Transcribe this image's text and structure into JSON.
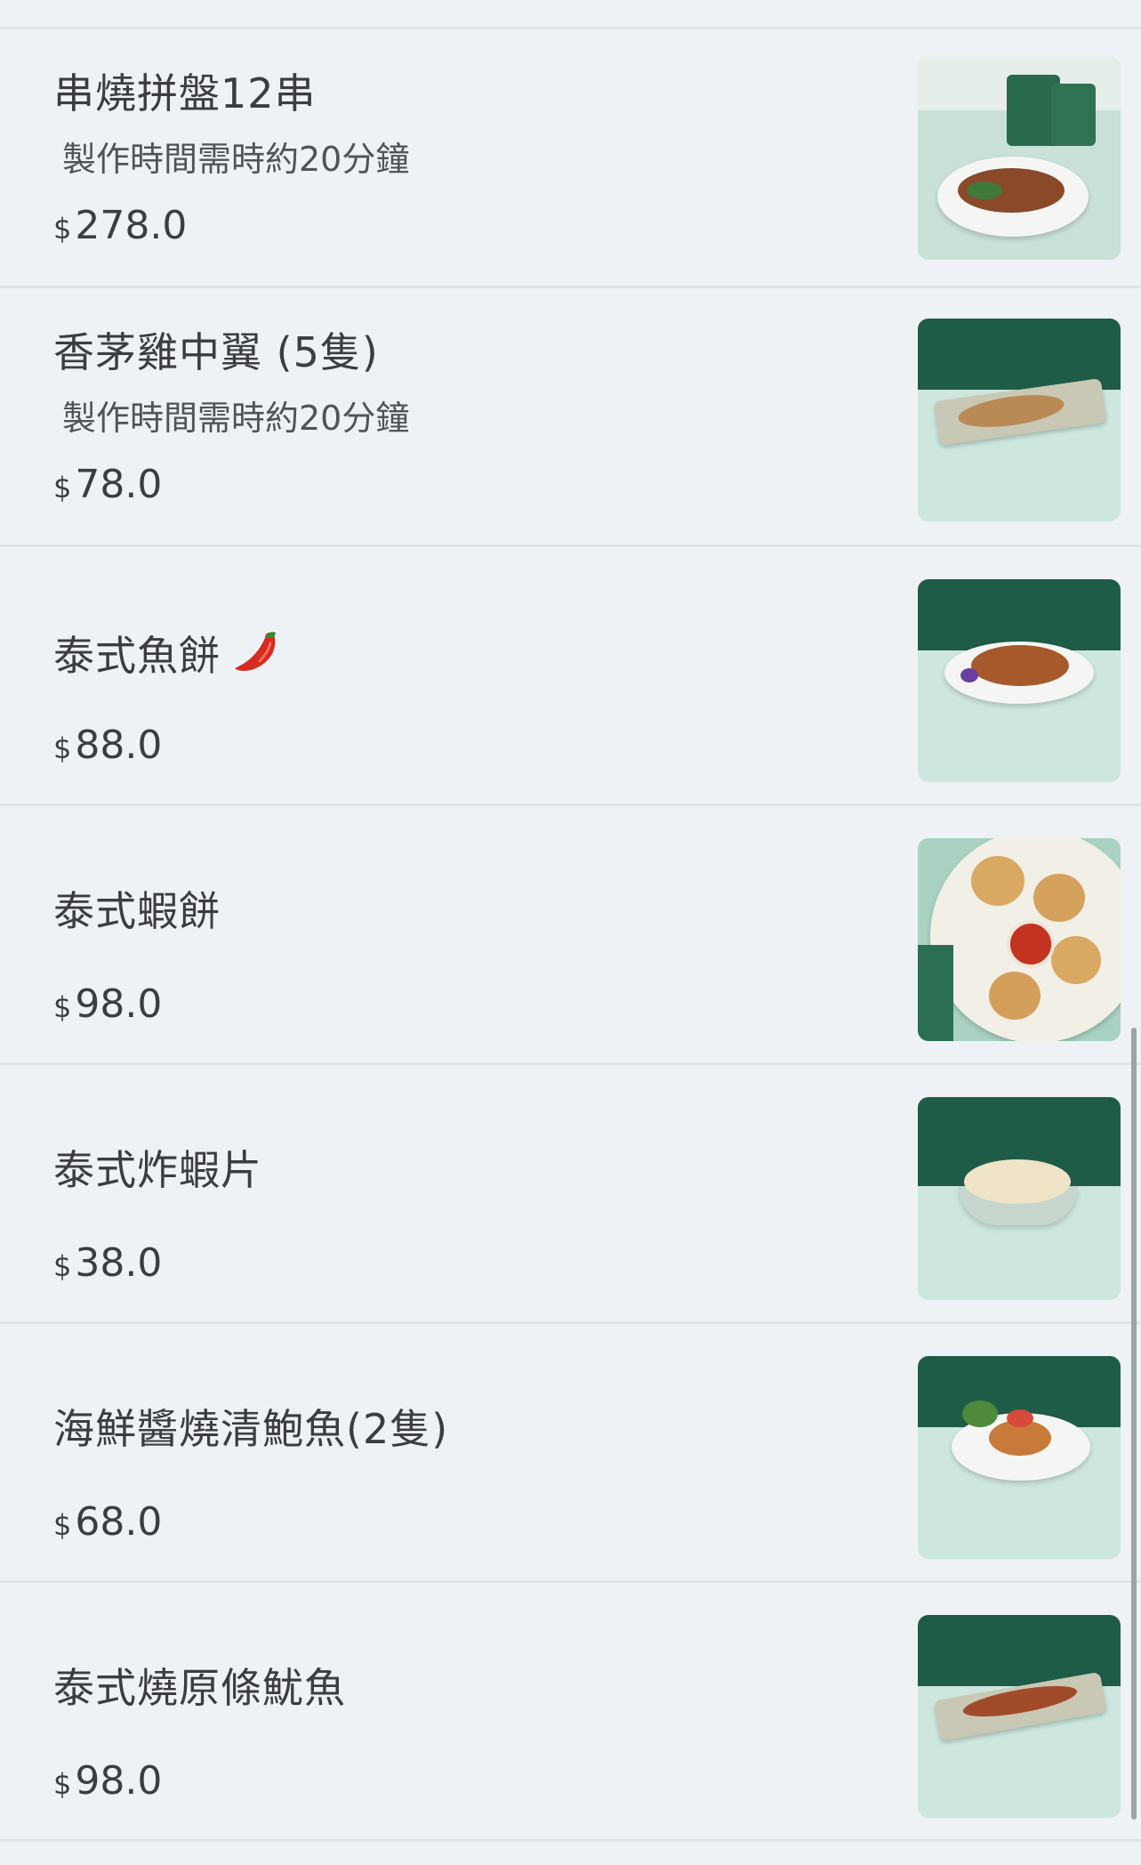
{
  "items": [
    {
      "name": "串燒拼盤12串",
      "note": "製作時間需時約20分鐘",
      "currency": "$",
      "price": "278.0",
      "photo_icon": "skewer-platter-photo"
    },
    {
      "name": "香茅雞中翼 (5隻)",
      "note": "製作時間需時約20分鐘",
      "currency": "$",
      "price": "78.0",
      "photo_icon": "chicken-wings-photo"
    },
    {
      "name": "泰式魚餅",
      "spicy_icon": "chili-pepper-icon",
      "currency": "$",
      "price": "88.0",
      "photo_icon": "fish-cake-photo"
    },
    {
      "name": "泰式蝦餅",
      "currency": "$",
      "price": "98.0",
      "photo_icon": "shrimp-cake-photo"
    },
    {
      "name": "泰式炸蝦片",
      "currency": "$",
      "price": "38.0",
      "photo_icon": "prawn-crackers-photo"
    },
    {
      "name": "海鮮醬燒清鮑魚(2隻)",
      "currency": "$",
      "price": "68.0",
      "photo_icon": "abalone-photo"
    },
    {
      "name": "泰式燒原條魷魚",
      "currency": "$",
      "price": "98.0",
      "photo_icon": "grilled-squid-photo"
    }
  ],
  "colors": {
    "background": "#eef1f5",
    "divider": "#dfe3e8",
    "wall_green": "#1f5c48",
    "table_mint": "#cde7df"
  }
}
